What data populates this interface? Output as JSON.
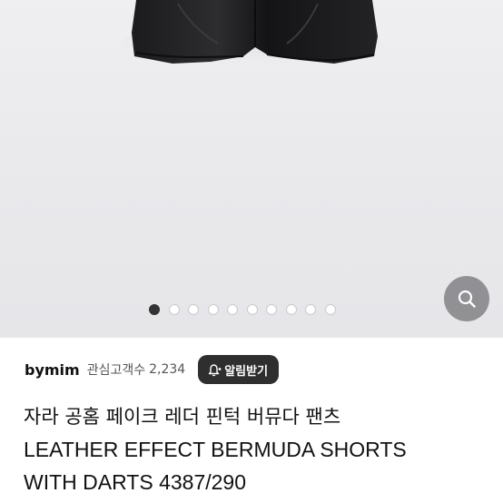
{
  "product": {
    "gallery": {
      "image_count": 10,
      "active_index": 0
    },
    "seller": {
      "name": "bymim",
      "follower_label": "관심고객수",
      "follower_count": "2,234",
      "alert_button_label": "알림받기"
    },
    "title_lines": [
      "자라 공홈 페이크 레더 핀턱 버뮤다 팬츠",
      "LEATHER EFFECT BERMUDA SHORTS",
      "WITH DARTS 4387/290"
    ]
  },
  "icons": {
    "zoom": "magnifier-icon",
    "alert": "bell-plus-icon"
  },
  "colors": {
    "gallery_background": "#ebebee",
    "dark_button": "#2f2f2f",
    "zoom_button": "#7a7a7e",
    "active_dot": "#333333"
  }
}
